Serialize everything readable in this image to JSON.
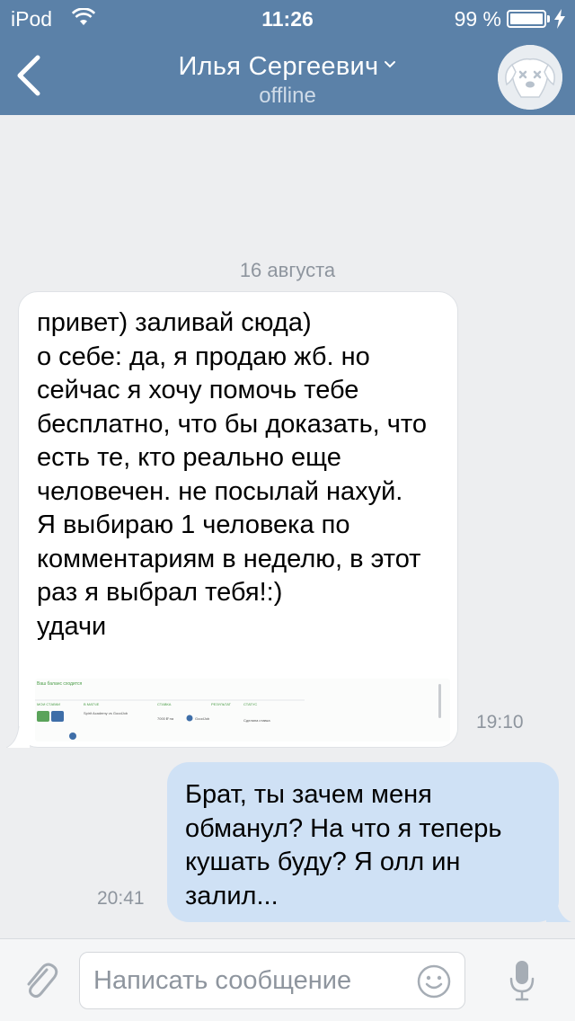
{
  "status_bar": {
    "carrier": "iPod",
    "time": "11:26",
    "battery_text": "99 %",
    "battery_level": 0.99
  },
  "nav": {
    "title": "Илья Сергеевич",
    "subtitle": "offline",
    "back_icon": "chevron-left-icon",
    "title_dropdown_icon": "chevron-down-icon",
    "avatar": "deactivated-dog-avatar"
  },
  "chat": {
    "date_separator": "16 августа",
    "messages": [
      {
        "direction": "incoming",
        "text": "привет) заливай сюда)\nо себе: да, я продаю жб. но сейчас я хочу помочь тебе бесплатно, что бы доказать, что есть те, кто реально еще человечен. не посылай нахуй.\nЯ выбираю 1 человека по комментариям в неделю, в этот раз я выбрал тебя!:)\nудачи",
        "time": "19:10",
        "attachment": {
          "kind": "screenshot-preview",
          "banner": "Ваш баланс сходится",
          "columns": [
            "МОИ СТАВКИ",
            "В МАТЧЕ",
            "СТАВКА",
            "РЕЗУЛЬТАТ",
            "СТАТУС"
          ],
          "match": "Spirit Academy vs GoodJob",
          "stake": "7000 ₽ на",
          "team": "GoodJob",
          "status": "Сделана ставка"
        }
      },
      {
        "direction": "outgoing",
        "text": "Брат, ты зачем меня обманул? На что я теперь кушать буду? Я олл ин залил...",
        "time": "20:41"
      }
    ]
  },
  "composer": {
    "placeholder": "Написать сообщение",
    "value": "",
    "attach_icon": "paperclip-icon",
    "emoji_icon": "smiley-icon",
    "mic_icon": "microphone-icon"
  },
  "colors": {
    "header_bg": "#5b81a8",
    "chat_bg": "#edeef0",
    "incoming_bubble": "#ffffff",
    "outgoing_bubble": "#cfe1f5",
    "meta_text": "#8e959e"
  }
}
